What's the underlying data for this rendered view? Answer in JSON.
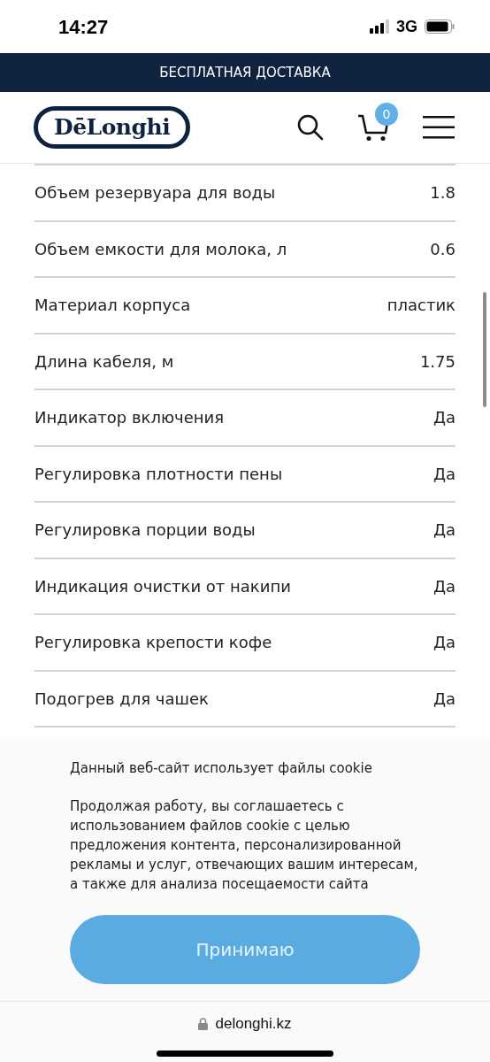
{
  "status_bar": {
    "time": "14:27",
    "network": "3G"
  },
  "promo_banner": {
    "text": "БЕСПЛАТНАЯ ДОСТАВКА"
  },
  "header": {
    "logo": "DēLonghi",
    "cart_count": "0"
  },
  "specs": [
    {
      "label": "Объем резервуара для воды",
      "value": "1.8"
    },
    {
      "label": "Объем емкости для молока, л",
      "value": "0.6"
    },
    {
      "label": "Материал корпуса",
      "value": "пластик"
    },
    {
      "label": "Длина кабеля, м",
      "value": "1.75"
    },
    {
      "label": "Индикатор включения",
      "value": "Да"
    },
    {
      "label": "Регулировка плотности пены",
      "value": "Да"
    },
    {
      "label": "Регулировка порции воды",
      "value": "Да"
    },
    {
      "label": "Индикация очистки от накипи",
      "value": "Да"
    },
    {
      "label": "Регулировка крепости кофе",
      "value": "Да"
    },
    {
      "label": "Подогрев для чашек",
      "value": "Да"
    }
  ],
  "cookie_notice": {
    "title": "Данный веб-сайт использует файлы cookie",
    "text": "Продолжая работу, вы соглашаетесь с использованием файлов cookie с целью предложения контента, персонализированной рекламы и услуг, отвечающих вашим интересам, а также для анализа посещаемости сайта",
    "button": "Принимаю"
  },
  "browser_bar": {
    "url": "delonghi.kz"
  }
}
